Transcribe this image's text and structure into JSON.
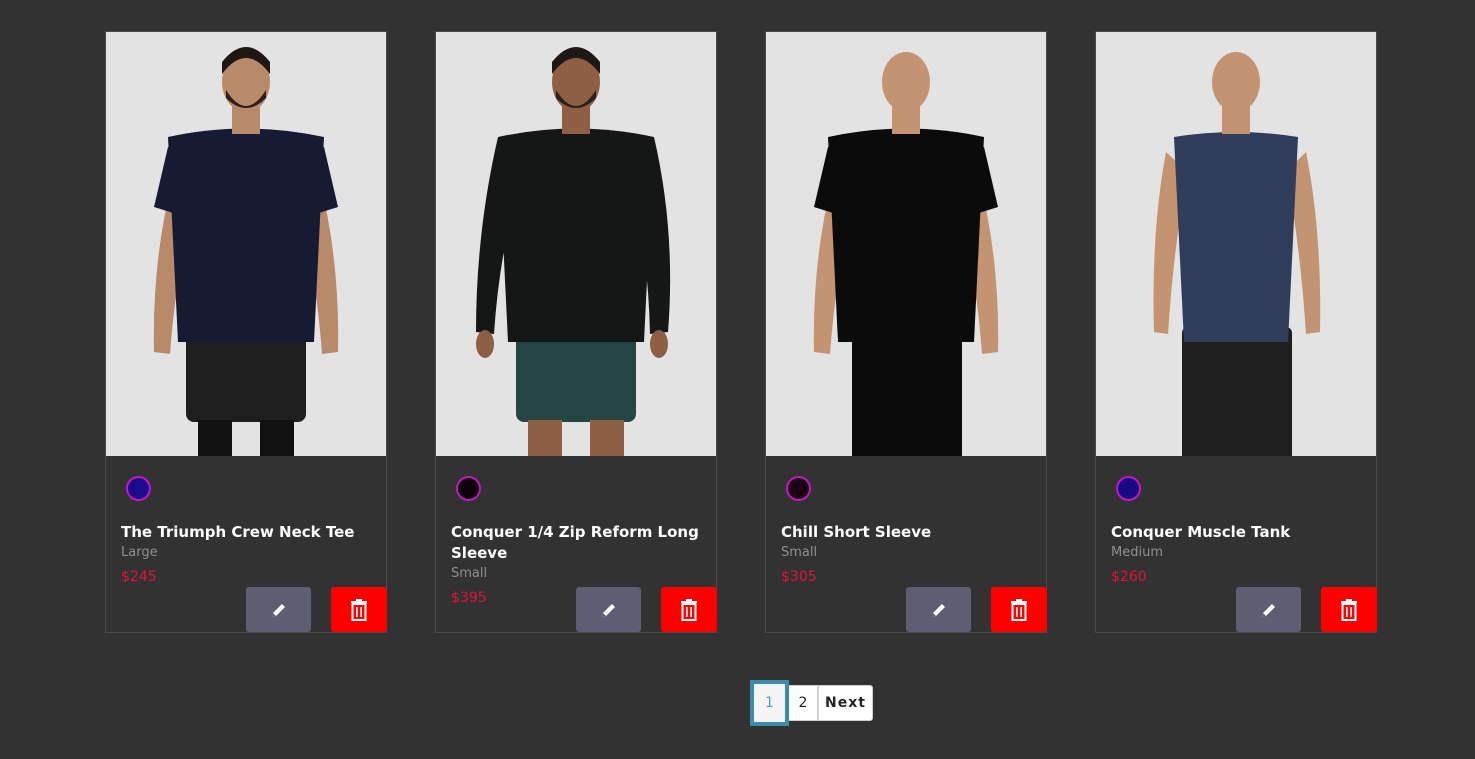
{
  "products": [
    {
      "name": "The Triumph Crew Neck Tee",
      "size": "Large",
      "price": "$245",
      "swatch_color": "#1a0a8c",
      "image": "model-navy-tee-black-shorts",
      "shirt_color": "#161a33",
      "bottom_color": "#1e1e1e",
      "skin": "#b98a6a"
    },
    {
      "name": "Conquer 1/4 Zip Reform Long Sleeve",
      "size": "Small",
      "price": "$395",
      "swatch_color": "#0d0208",
      "image": "model-black-quarter-zip-green-shorts",
      "shirt_color": "#151616",
      "bottom_color": "#234644",
      "skin": "#8e5f45"
    },
    {
      "name": "Chill Short Sleeve",
      "size": "Small",
      "price": "$305",
      "swatch_color": "#1a0210",
      "image": "model-black-tee-black-pants",
      "shirt_color": "#0b0b0b",
      "bottom_color": "#0b0b0b",
      "skin": "#c49372"
    },
    {
      "name": "Conquer Muscle Tank",
      "size": "Medium",
      "price": "$260",
      "swatch_color": "#170a80",
      "image": "model-navy-tank-black-pants",
      "shirt_color": "#2f3d5a",
      "bottom_color": "#1e1e1e",
      "skin": "#c49372"
    }
  ],
  "actions": {
    "edit_icon": "pencil-icon",
    "delete_icon": "trash-icon",
    "edit_color": "#5d5e72",
    "delete_color": "#ff0000"
  },
  "pagination": {
    "pages": [
      "1",
      "2"
    ],
    "current": "1",
    "next_label": "Next"
  }
}
